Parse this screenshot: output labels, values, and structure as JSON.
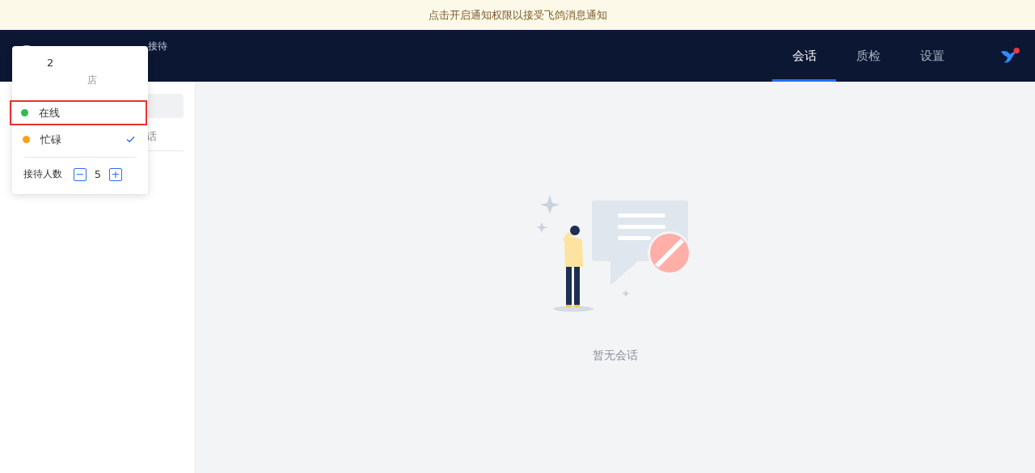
{
  "banner": {
    "text": "点击开启通知权限以接受飞鸽消息通知"
  },
  "header": {
    "left_items": [
      "接待"
    ],
    "tabs": [
      {
        "label": "会话",
        "selected": true
      },
      {
        "label": "质检",
        "selected": false
      },
      {
        "label": "设置",
        "selected": false
      }
    ],
    "notification_dot": true
  },
  "sidebar": {
    "tab_label": "话"
  },
  "dropdown": {
    "user_name": "2",
    "shop_name": "店",
    "statuses": [
      {
        "label": "在线",
        "color": "#2ebd4e",
        "checked": false,
        "highlighted": true
      },
      {
        "label": "忙碌",
        "color": "#ff9f1a",
        "checked": true,
        "highlighted": false
      }
    ],
    "capacity": {
      "label": "接待人数",
      "minus": "−",
      "value": "5",
      "plus": "+"
    }
  },
  "empty_state": {
    "text": "暂无会话"
  }
}
